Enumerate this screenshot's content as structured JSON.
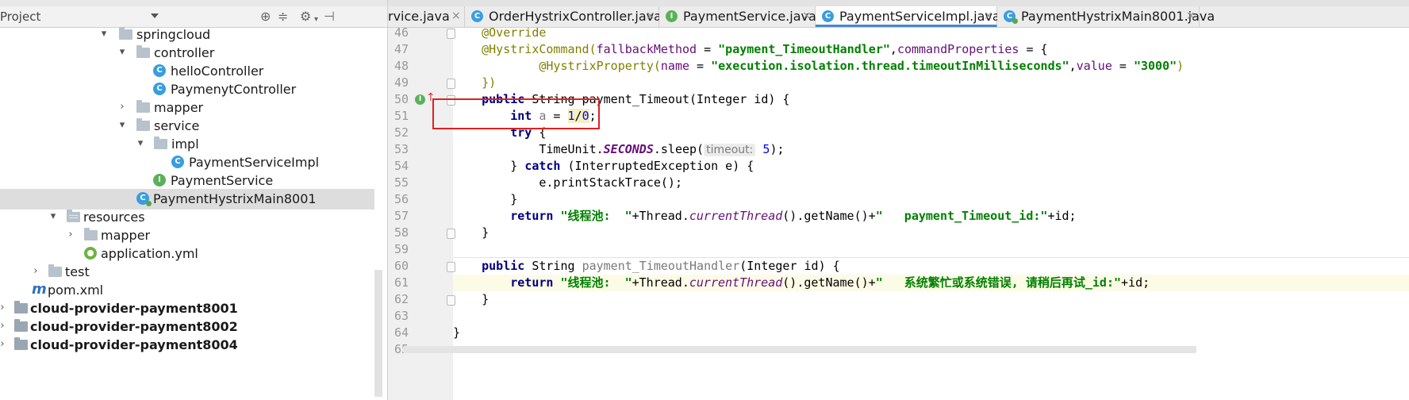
{
  "project_panel": {
    "title": "Project",
    "tree": [
      {
        "label": "springcloud",
        "arrow": "▾",
        "kind": "folder"
      },
      {
        "label": "controller",
        "arrow": "▾",
        "kind": "folder"
      },
      {
        "label": "helloController",
        "arrow": "",
        "kind": "class"
      },
      {
        "label": "PaymenytController",
        "arrow": "",
        "kind": "class"
      },
      {
        "label": "mapper",
        "arrow": "›",
        "kind": "folder"
      },
      {
        "label": "service",
        "arrow": "▾",
        "kind": "folder"
      },
      {
        "label": "impl",
        "arrow": "▾",
        "kind": "folder"
      },
      {
        "label": "PaymentServiceImpl",
        "arrow": "",
        "kind": "class"
      },
      {
        "label": "PaymentService",
        "arrow": "",
        "kind": "interface"
      },
      {
        "label": "PaymentHystrixMain8001",
        "arrow": "",
        "kind": "main",
        "selected": true
      },
      {
        "label": "resources",
        "arrow": "▾",
        "kind": "res-folder"
      },
      {
        "label": "mapper",
        "arrow": "›",
        "kind": "folder"
      },
      {
        "label": "application.yml",
        "arrow": "",
        "kind": "yml"
      },
      {
        "label": "test",
        "arrow": "›",
        "kind": "folder"
      },
      {
        "label": "pom.xml",
        "arrow": "",
        "kind": "pom"
      },
      {
        "label": "cloud-provider-payment8001",
        "arrow": "›",
        "kind": "module"
      },
      {
        "label": "cloud-provider-payment8002",
        "arrow": "›",
        "kind": "module"
      },
      {
        "label": "cloud-provider-payment8004",
        "arrow": "›",
        "kind": "module"
      }
    ]
  },
  "tabs": [
    {
      "label": "rvice.java",
      "icon": ""
    },
    {
      "label": "OrderHystrixController.java",
      "icon": "C"
    },
    {
      "label": "PaymentService.java",
      "icon": "I"
    },
    {
      "label": "PaymentServiceImpl.java",
      "icon": "C",
      "active": true
    },
    {
      "label": "PaymentHystrixMain8001.java",
      "icon": "C"
    }
  ],
  "tab_close": "×",
  "editor": {
    "hint_timeout": "timeout:",
    "lines": [
      "46",
      "47",
      "48",
      "49",
      "50",
      "51",
      "52",
      "53",
      "54",
      "55",
      "56",
      "57",
      "58",
      "59",
      "60",
      "61",
      "62",
      "63",
      "64",
      "65"
    ],
    "code": {
      "l46": "@Override",
      "l47_a": "@HystrixCommand(",
      "l47_b": "fallbackMethod",
      "l47_c": " = ",
      "l47_d": "\"payment_TimeoutHandler\"",
      "l47_e": ",",
      "l47_f": "commandProperties",
      "l47_g": " = {",
      "l48_a": "@HystrixProperty(",
      "l48_b": "name",
      "l48_c": " = ",
      "l48_d": "\"execution.isolation.thread.timeoutInMilliseconds\"",
      "l48_e": ",",
      "l48_f": "value",
      "l48_g": " = ",
      "l48_h": "\"3000\"",
      "l48_i": ")",
      "l49": "})",
      "l50_a": "public",
      "l50_b": " String payment_Timeout(Integer id) {",
      "l51_a": "int",
      "l51_b": " a",
      "l51_c": " = ",
      "l51_d": "1",
      "l51_e": "/",
      "l51_f": "0",
      "l51_g": ";",
      "l52_a": "try",
      "l52_b": " {",
      "l53_a": "TimeUnit.",
      "l53_b": "SECONDS",
      "l53_c": ".sleep(",
      "l53_d": "5",
      "l53_e": ");",
      "l54_a": "} ",
      "l54_b": "catch",
      "l54_c": " (InterruptedException e) {",
      "l55": "e.printStackTrace();",
      "l56": "}",
      "l57_a": "return",
      "l57_b": " \"线程池:  \"",
      "l57_c": "+Thread.",
      "l57_d": "currentThread",
      "l57_e": "().getName()+",
      "l57_f": "\"   payment_Timeout_id:\"",
      "l57_g": "+id;",
      "l58": "}",
      "l60_a": "public",
      "l60_b": " String ",
      "l60_c": "payment_TimeoutHandler",
      "l60_d": "(Integer id) {",
      "l61_a": "return",
      "l61_b": " \"线程池:  \"",
      "l61_c": "+Thread.",
      "l61_d": "currentThread",
      "l61_e": "().getName()+",
      "l61_f": "\"   系统繁忙或系统错误, 请稍后再试_id:\"",
      "l61_g": "+id;",
      "l62": "}",
      "l64": "}"
    }
  }
}
